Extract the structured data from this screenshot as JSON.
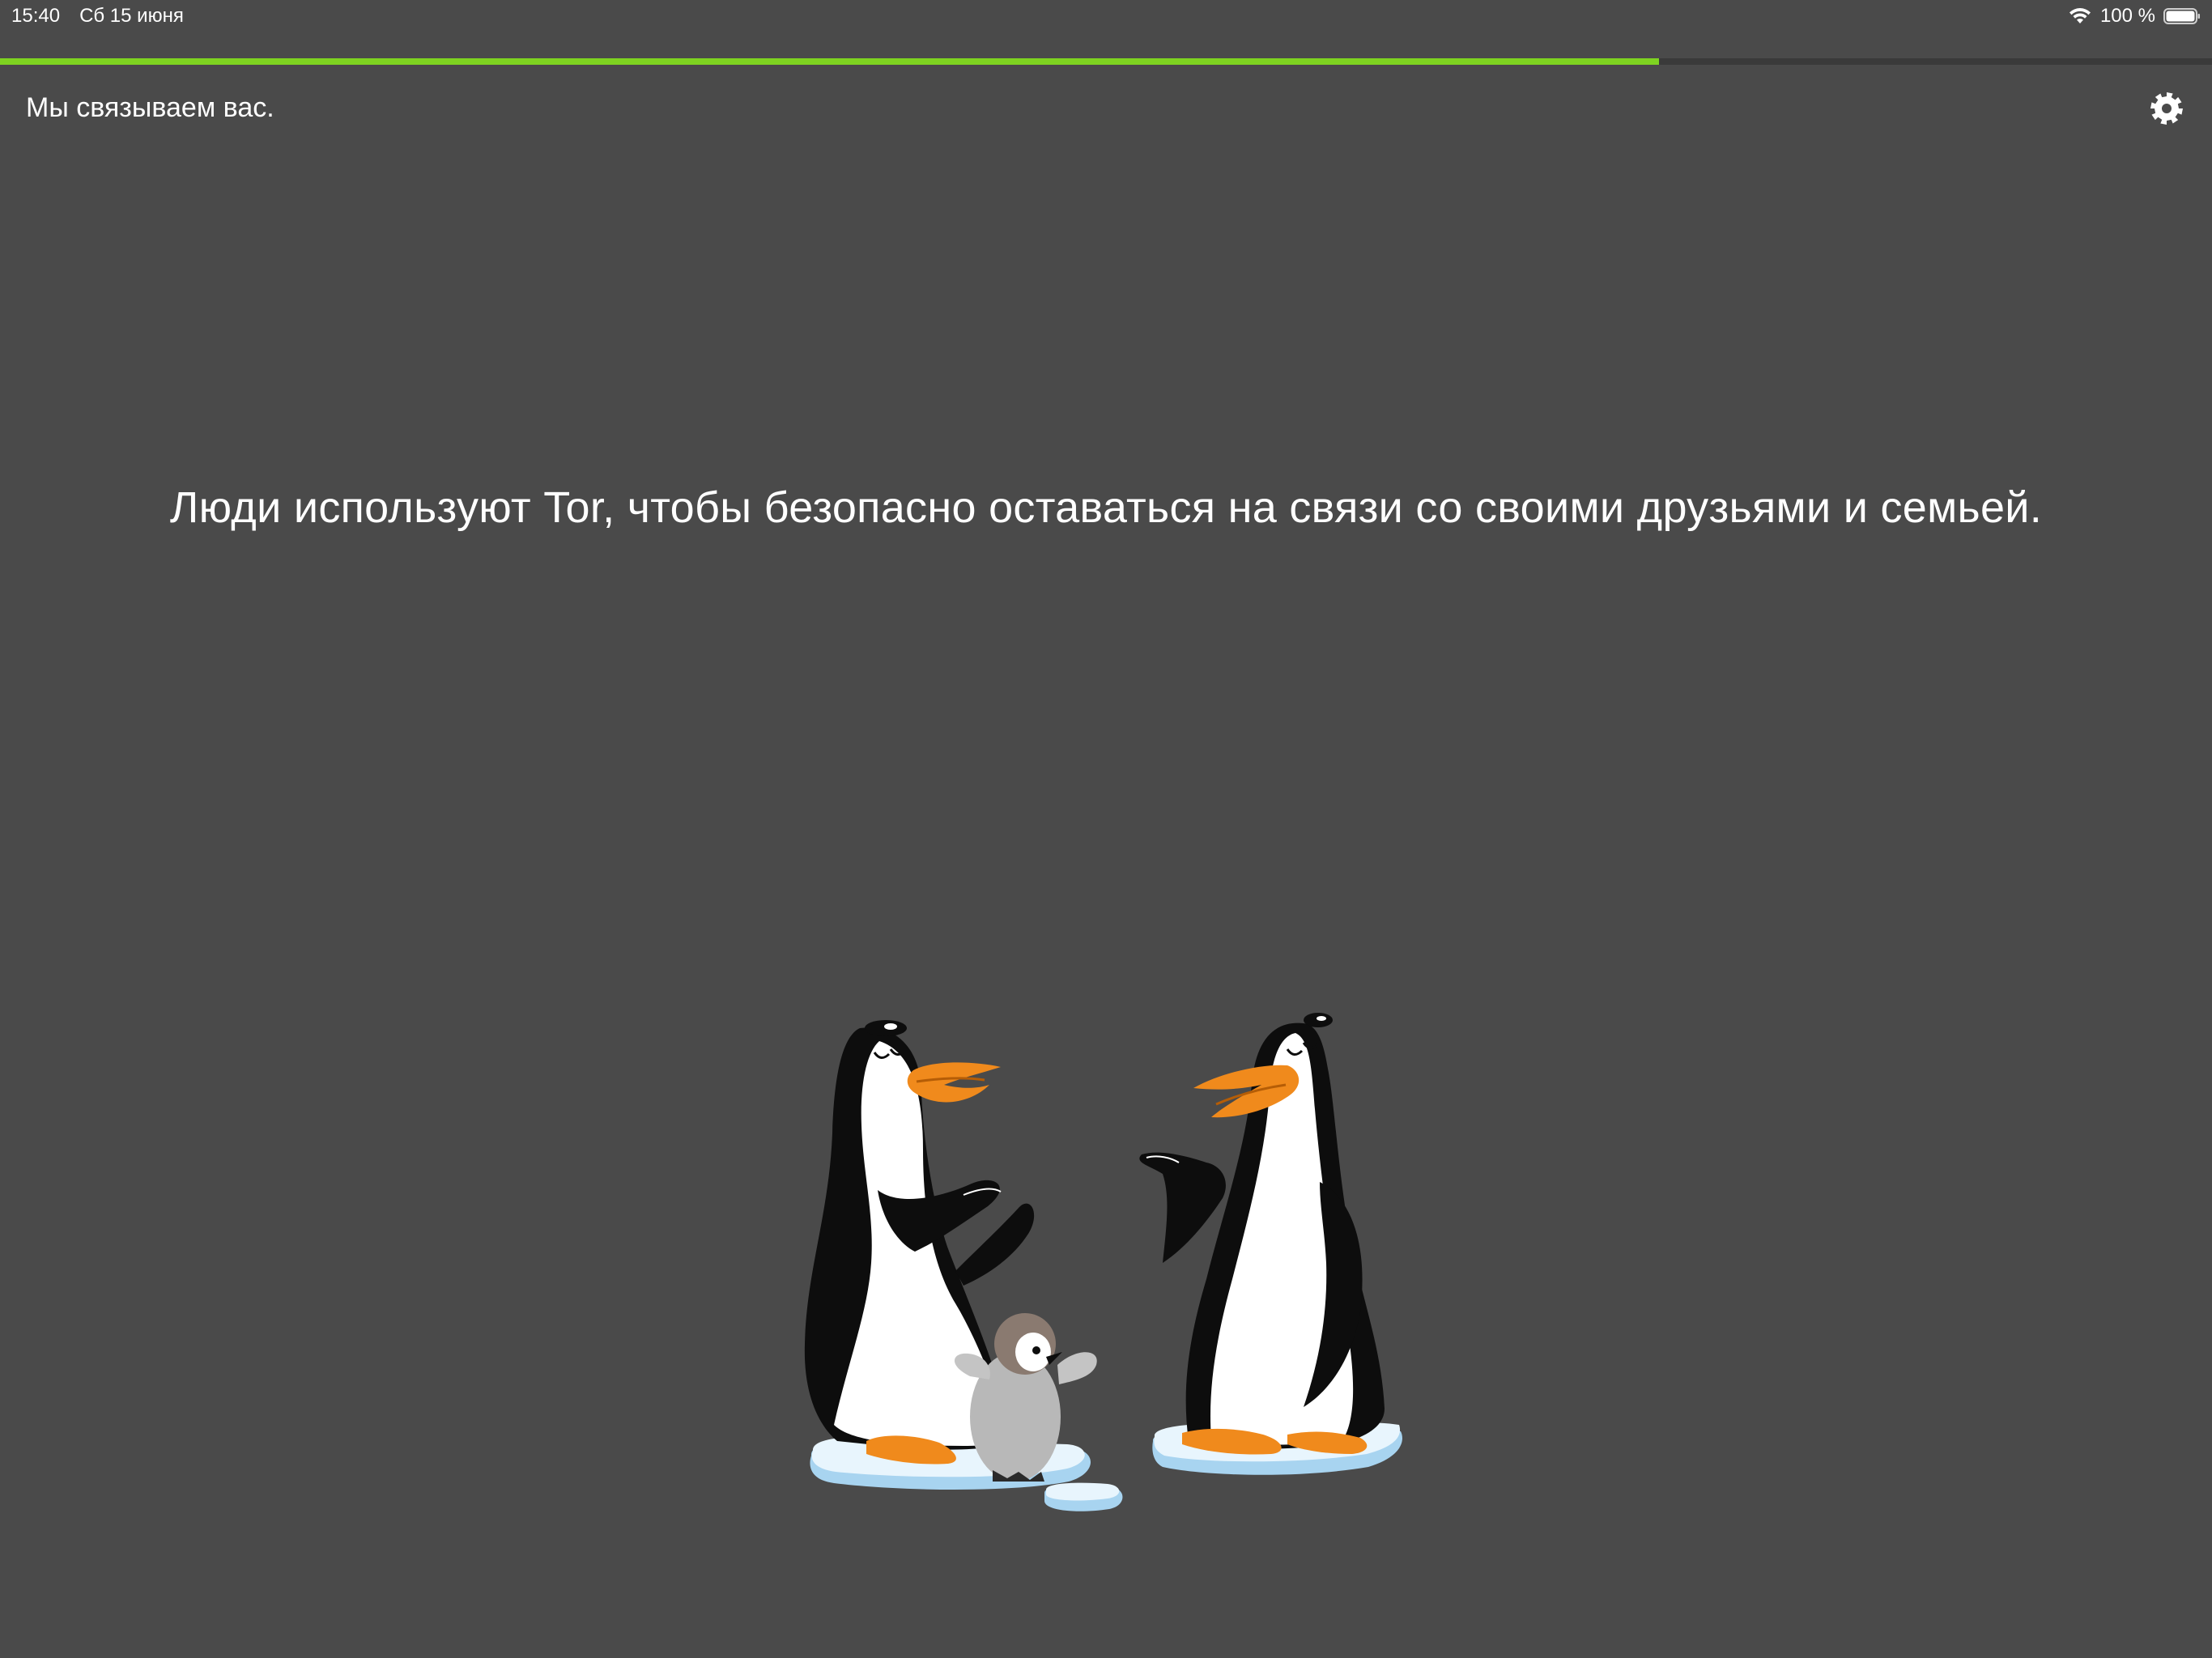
{
  "status_bar": {
    "time": "15:40",
    "date": "Сб 15 июня",
    "battery_percent": "100 %",
    "wifi_icon": "wifi-icon",
    "battery_icon": "battery-icon"
  },
  "progress": {
    "fraction": 0.75,
    "color": "#7ed321"
  },
  "header": {
    "title": "Мы связываем вас.",
    "settings_icon": "gear-icon"
  },
  "message": {
    "text": "Люди используют Tor, чтобы безопасно оставаться на связи со своими друзьями и семьей."
  },
  "illustration": {
    "name": "penguin-family-illustration"
  },
  "colors": {
    "background": "#4a4a4a",
    "accent": "#7ed321",
    "text": "#ffffff"
  }
}
